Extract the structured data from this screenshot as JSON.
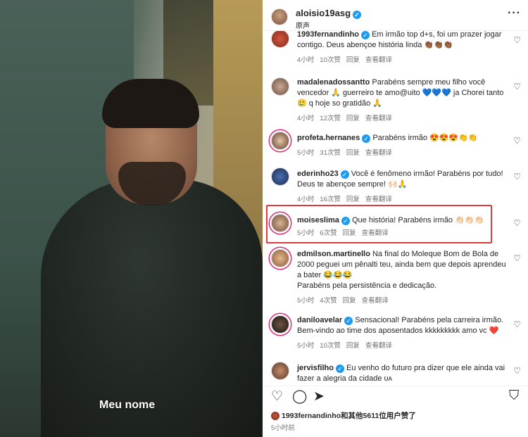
{
  "video": {
    "caption": "Meu nome"
  },
  "header": {
    "username": "aloisio19asg",
    "audio": "原声",
    "more_icon": "more-horizontal-icon"
  },
  "comments": [
    {
      "username": "1993fernandinho",
      "text": "Em irmão top d+s, foi um prazer jogar contigo. Deus abençoe história linda 👏🏾👏🏾👏🏾",
      "time": "4小时",
      "likes": "10次赞",
      "reply": "回复",
      "translate": "查看翻译"
    },
    {
      "username": "madalenadossantto",
      "text": "Parabéns sempre meu filho você vencedor 🙏 guerreiro te amo@uito 💙💙💙 ja Chorei tanto 🥲 q hoje so gratidão 🙏",
      "time": "4小时",
      "likes": "12次赞",
      "reply": "回复",
      "translate": "查看翻译"
    },
    {
      "username": "profeta.hernanes",
      "text": "Parabéns irmão 😍😍😍👏👏",
      "time": "5小时",
      "likes": "31次赞",
      "reply": "回复",
      "translate": "查看翻译"
    },
    {
      "username": "ederinho23",
      "text": "Você é fenômeno irmão! Parabéns por tudo! Deus te abençoe sempre! 🙌🏻🙏",
      "time": "4小时",
      "likes": "16次赞",
      "reply": "回复",
      "translate": "查看翻译"
    },
    {
      "username": "moiseslima",
      "text": "Que história! Parabéns irmão 👏🏻👏🏻👏🏻",
      "time": "5小时",
      "likes": "6次赞",
      "reply": "回复",
      "translate": "查看翻译"
    },
    {
      "username": "edmilson.martinello",
      "text": "Na final do Moleque Bom de Bola de 2000 peguei um pênalti teu, ainda bem que depois aprendeu a bater 😂😂😂",
      "text2": "Parabéns pela persistência e dedicação.",
      "time": "5小时",
      "likes": "4次赞",
      "reply": "回复",
      "translate": "查看翻译"
    },
    {
      "username": "daniloavelar",
      "text": "Sensacional! Parabéns pela carreira irmão. Bem-vindo ao time dos aposentados kkkkkkkkk amo vc ❤️",
      "time": "5小时",
      "likes": "10次赞",
      "reply": "回复",
      "translate": "查看翻译"
    },
    {
      "username": "jervisfilho",
      "text": "Eu venho do futuro pra dizer que ele ainda vai fazer a alegria da cidade ᴜᴀ",
      "time": "",
      "likes": "",
      "reply": "",
      "translate": ""
    }
  ],
  "footer": {
    "liked_by": "1993fernandinho和其他5611位用户赞了",
    "posted": "5小时前"
  },
  "colors": {
    "verified": "#1d9bf0",
    "highlight": "#e03a3a",
    "like": "#ed4956"
  }
}
